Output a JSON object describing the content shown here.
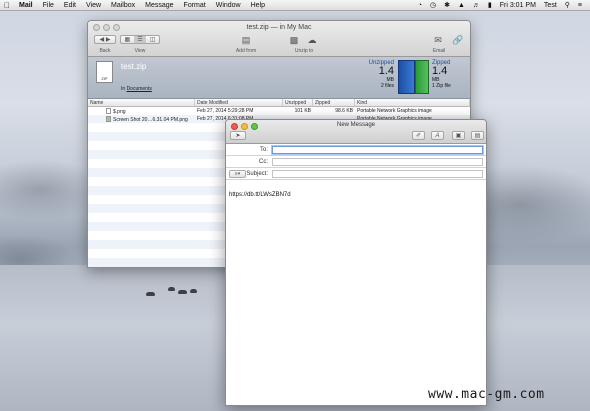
{
  "menubar": {
    "app": "Mail",
    "items": [
      "File",
      "Edit",
      "View",
      "Mailbox",
      "Message",
      "Format",
      "Window",
      "Help"
    ],
    "clock": "Fri 3:01 PM",
    "user": "Test"
  },
  "archive_window": {
    "title": "test.zip — in My Mac",
    "toolbar": {
      "back_label": "Back",
      "view_label": "View",
      "add_from_label": "Add from",
      "unzip_to_label": "Unzip to",
      "email_label": "Email"
    },
    "info": {
      "name": "test.zip",
      "location_prefix": "In",
      "location": "Documents",
      "doc_badge": "ZIP",
      "unzipped": {
        "head": "Unzipped",
        "value": "1.4",
        "unit": "MB",
        "sub": "2 files"
      },
      "zipped": {
        "head": "Zipped",
        "value": "1.4",
        "unit": "MB",
        "sub": "1 Zip file"
      }
    },
    "columns": [
      "Name",
      "Date Modified",
      "Unzipped",
      "Zipped",
      "Kind"
    ],
    "rows": [
      {
        "name": "$.png",
        "date": "Feb 27, 2014 5:29:28 PM",
        "unzipped": "101 KB",
        "zipped": "98.6 KB",
        "kind": "Portable Network Graphics image"
      },
      {
        "name": "Screen Shot 20…6.31.04 PM.png",
        "date": "Feb 27, 2014 6:31:08 PM",
        "unzipped": "",
        "zipped": "",
        "kind": "Portable Network Graphics image"
      }
    ]
  },
  "message_window": {
    "title": "New Message",
    "to_label": "To:",
    "cc_label": "Cc:",
    "subject_label": "Subject:",
    "to_value": "",
    "cc_value": "",
    "subject_value": "",
    "body": "https://db.tt/LWsZBN7d"
  },
  "watermark": "www.mac-gm.com"
}
